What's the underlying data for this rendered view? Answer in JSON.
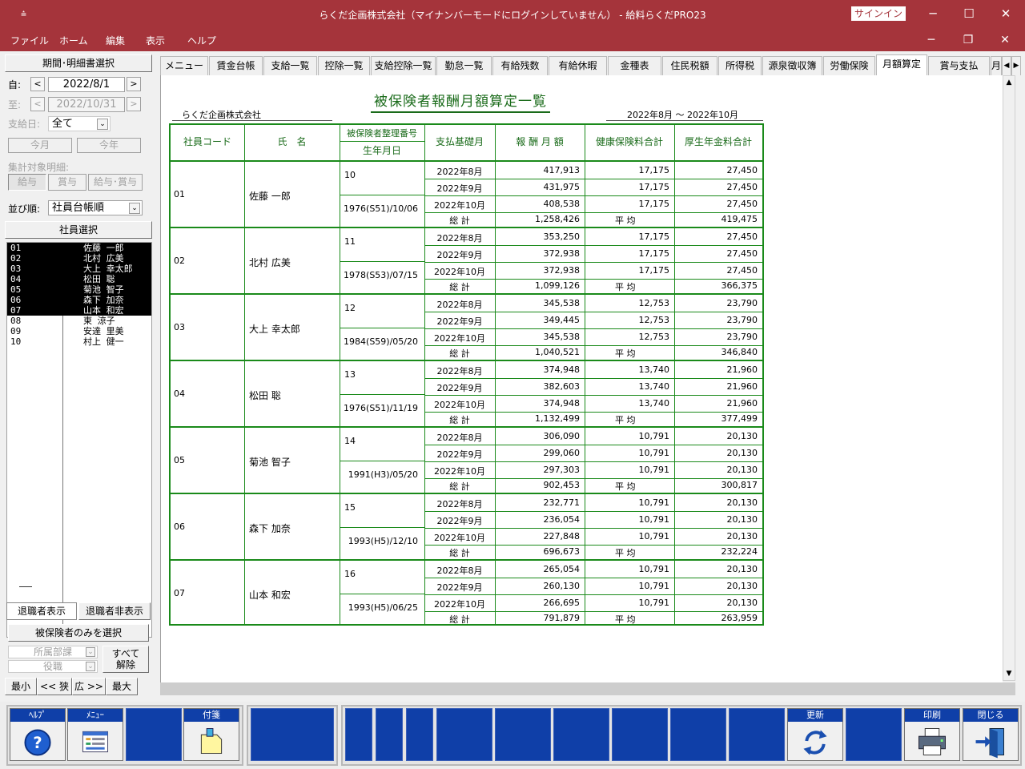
{
  "window": {
    "title": "らくだ企画株式会社（マイナンバーモードにログインしていません） - 給料らくだPRO23",
    "signin": "サインイン",
    "minimize": "─",
    "maximize": "☐",
    "close": "✕"
  },
  "menubar": {
    "items": [
      "ファイル",
      "ホーム",
      "編集",
      "表示",
      "ヘルプ"
    ],
    "doc_minimize": "─",
    "doc_restore": "❐",
    "doc_close": "✕"
  },
  "left": {
    "period_button": "期間･明細書選択",
    "from_label": "自:",
    "from_date": "2022/8/1",
    "to_label": "至:",
    "to_date": "2022/10/31",
    "payday_label": "支給日:",
    "payday_value": "全て",
    "this_month": "今月",
    "this_year": "今年",
    "aggregate_label": "集計対象明細:",
    "agg_salary": "給与",
    "agg_bonus": "賞与",
    "agg_both": "給与･賞与",
    "sort_label": "並び順:",
    "sort_value": "社員台帳順",
    "employee_select": "社員選択",
    "employees": [
      {
        "code": "01",
        "name": "佐藤 一郎",
        "selected": true
      },
      {
        "code": "02",
        "name": "北村 広美",
        "selected": true
      },
      {
        "code": "03",
        "name": "大上 幸太郎",
        "selected": true
      },
      {
        "code": "04",
        "name": "松田 聡",
        "selected": true
      },
      {
        "code": "05",
        "name": "菊池 智子",
        "selected": true
      },
      {
        "code": "06",
        "name": "森下 加奈",
        "selected": true
      },
      {
        "code": "07",
        "name": "山本 和宏",
        "selected": true
      },
      {
        "code": "08",
        "name": "東 涼子",
        "selected": false
      },
      {
        "code": "09",
        "name": "安達 里美",
        "selected": false
      },
      {
        "code": "10",
        "name": "村上 健一",
        "selected": false
      }
    ],
    "show_retired": "退職者表示",
    "hide_retired": "退職者非表示",
    "insured_only": "被保険者のみを選択",
    "department": "所属部課",
    "position": "役職",
    "clear_all_1": "すべて",
    "clear_all_2": "解除",
    "min": "最小",
    "narrow": "<< 狭",
    "wide": "広 >>",
    "max": "最大"
  },
  "tabs": [
    "メニュー",
    "賃金台帳",
    "支給一覧",
    "控除一覧",
    "支給控除一覧",
    "勤怠一覧",
    "有給残数",
    "有給休暇",
    "金種表",
    "住民税額",
    "所得税",
    "源泉徴収簿",
    "労働保険",
    "月額算定",
    "賞与支払",
    "月"
  ],
  "active_tab": "月額算定",
  "report": {
    "title": "被保険者報酬月額算定一覧",
    "company": "らくだ企画株式会社",
    "period": "2022年8月 ～ 2022年10月",
    "headers": {
      "code": "社員コード",
      "name": "氏　名",
      "insured_no": "被保険者整理番号",
      "birth": "生年月日",
      "month": "支払基礎月",
      "salary": "報 酬 月 額",
      "health": "健康保険料合計",
      "pension": "厚生年金料合計"
    },
    "total_label": "総 計",
    "avg_label": "平 均",
    "rows": [
      {
        "code": "01",
        "name": "佐藤 一郎",
        "ins": "10",
        "birth": "1976(S51)/10/06",
        "months": [
          [
            "2022年8月",
            "417,913",
            "17,175",
            "27,450"
          ],
          [
            "2022年9月",
            "431,975",
            "17,175",
            "27,450"
          ],
          [
            "2022年10月",
            "408,538",
            "17,175",
            "27,450"
          ]
        ],
        "total": "1,258,426",
        "avg": "419,475"
      },
      {
        "code": "02",
        "name": "北村 広美",
        "ins": "11",
        "birth": "1978(S53)/07/15",
        "months": [
          [
            "2022年8月",
            "353,250",
            "17,175",
            "27,450"
          ],
          [
            "2022年9月",
            "372,938",
            "17,175",
            "27,450"
          ],
          [
            "2022年10月",
            "372,938",
            "17,175",
            "27,450"
          ]
        ],
        "total": "1,099,126",
        "avg": "366,375"
      },
      {
        "code": "03",
        "name": "大上 幸太郎",
        "ins": "12",
        "birth": "1984(S59)/05/20",
        "months": [
          [
            "2022年8月",
            "345,538",
            "12,753",
            "23,790"
          ],
          [
            "2022年9月",
            "349,445",
            "12,753",
            "23,790"
          ],
          [
            "2022年10月",
            "345,538",
            "12,753",
            "23,790"
          ]
        ],
        "total": "1,040,521",
        "avg": "346,840"
      },
      {
        "code": "04",
        "name": "松田 聡",
        "ins": "13",
        "birth": "1976(S51)/11/19",
        "months": [
          [
            "2022年8月",
            "374,948",
            "13,740",
            "21,960"
          ],
          [
            "2022年9月",
            "382,603",
            "13,740",
            "21,960"
          ],
          [
            "2022年10月",
            "374,948",
            "13,740",
            "21,960"
          ]
        ],
        "total": "1,132,499",
        "avg": "377,499"
      },
      {
        "code": "05",
        "name": "菊池 智子",
        "ins": "14",
        "birth": "1991(H3)/05/20",
        "months": [
          [
            "2022年8月",
            "306,090",
            "10,791",
            "20,130"
          ],
          [
            "2022年9月",
            "299,060",
            "10,791",
            "20,130"
          ],
          [
            "2022年10月",
            "297,303",
            "10,791",
            "20,130"
          ]
        ],
        "total": "902,453",
        "avg": "300,817"
      },
      {
        "code": "06",
        "name": "森下 加奈",
        "ins": "15",
        "birth": "1993(H5)/12/10",
        "months": [
          [
            "2022年8月",
            "232,771",
            "10,791",
            "20,130"
          ],
          [
            "2022年9月",
            "236,054",
            "10,791",
            "20,130"
          ],
          [
            "2022年10月",
            "227,848",
            "10,791",
            "20,130"
          ]
        ],
        "total": "696,673",
        "avg": "232,224"
      },
      {
        "code": "07",
        "name": "山本 和宏",
        "ins": "16",
        "birth": "1993(H5)/06/25",
        "months": [
          [
            "2022年8月",
            "265,054",
            "10,791",
            "20,130"
          ],
          [
            "2022年9月",
            "260,130",
            "10,791",
            "20,130"
          ],
          [
            "2022年10月",
            "266,695",
            "10,791",
            "20,130"
          ]
        ],
        "total": "791,879",
        "avg": "263,959"
      }
    ]
  },
  "fkeys": {
    "help": "ﾍﾙﾌﾟ",
    "menu": "ﾒﾆｭｰ",
    "sticky": "付箋",
    "refresh": "更新",
    "print": "印刷",
    "close": "閉じる"
  },
  "colors": {
    "titlebar": "#a5343b",
    "report_green": "#1a8a1a",
    "fkey_blue": "#0f3fa8"
  }
}
